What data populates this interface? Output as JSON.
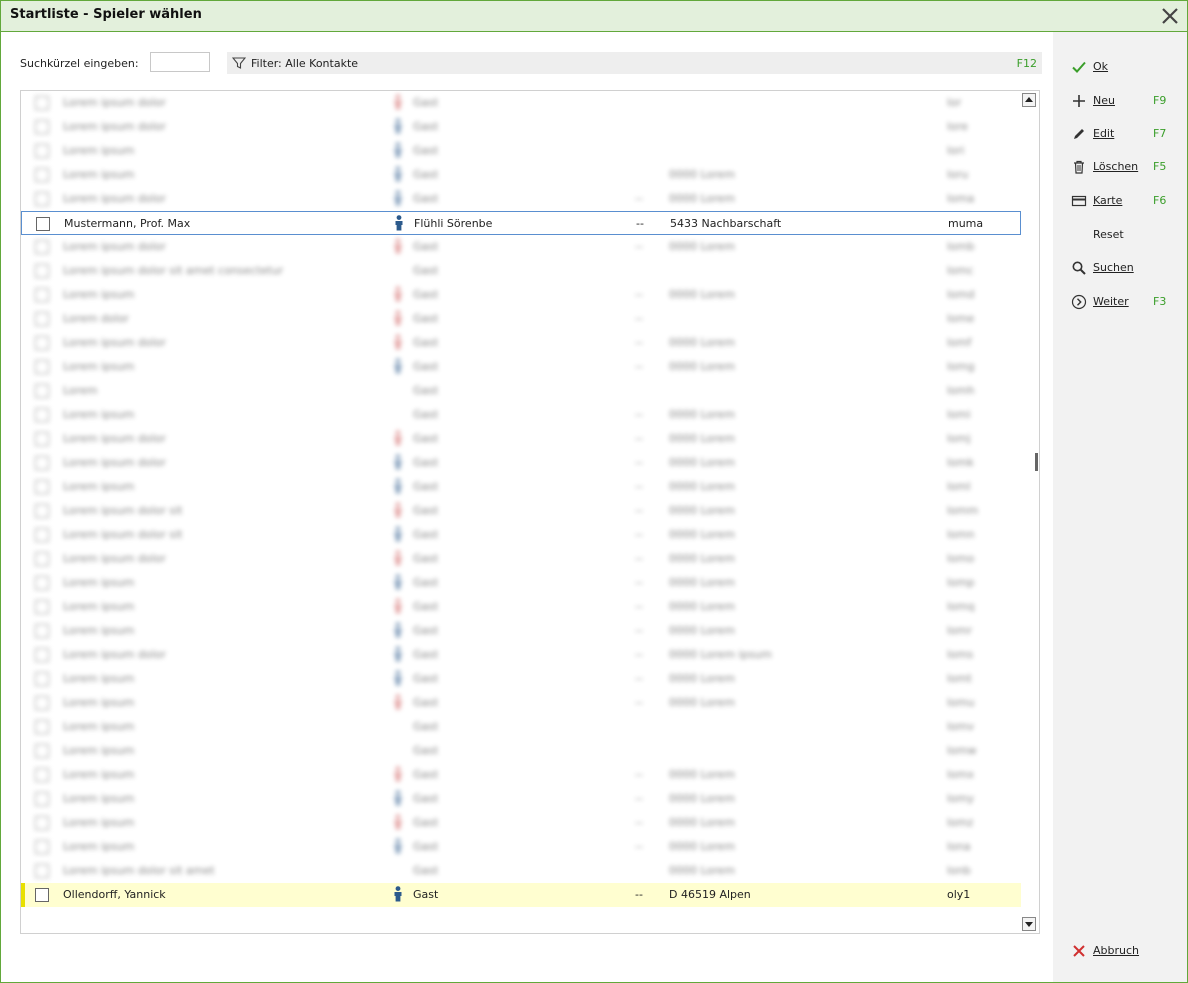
{
  "window": {
    "title": "Startliste - Spieler wählen"
  },
  "search": {
    "label": "Suchkürzel eingeben:",
    "value": "",
    "placeholder": ""
  },
  "filter": {
    "label": "Filter: Alle Kontakte",
    "shortcut": "F12"
  },
  "rows": [
    {
      "name": "Mustermann, Prof. Max",
      "club": "Flühli Sörenbe",
      "dash": "--",
      "address": "5433 Nachbarschaft",
      "code": "muma",
      "state": "selected"
    },
    {
      "name": "Ollendorff, Yannick",
      "club": "Gast",
      "dash": "--",
      "address": "D 46519 Alpen",
      "code": "oly1",
      "state": "highlighted"
    }
  ],
  "blurred_rows": [
    {
      "name": "Lorem ipsum dolor",
      "club": "Gast",
      "dash": "",
      "address": "",
      "code": "lor",
      "icon": "female"
    },
    {
      "name": "Lorem ipsum dolor",
      "club": "Gast",
      "dash": "",
      "address": "",
      "code": "lore",
      "icon": "male"
    },
    {
      "name": "Lorem ipsum",
      "club": "Gast",
      "dash": "",
      "address": "",
      "code": "lori",
      "icon": "male"
    },
    {
      "name": "Lorem ipsum",
      "club": "Gast",
      "dash": "",
      "address": "0000 Lorem",
      "code": "loru",
      "icon": "male"
    },
    {
      "name": "Lorem ipsum dolor",
      "club": "Gast",
      "dash": "--",
      "address": "0000 Lorem",
      "code": "loma",
      "icon": "male"
    },
    {
      "name": "Lorem ipsum dolor",
      "club": "Gast",
      "dash": "--",
      "address": "0000 Lorem",
      "code": "lomb",
      "icon": "female"
    },
    {
      "name": "Lorem ipsum dolor sit amet consectetur",
      "club": "Gast",
      "dash": "",
      "address": "",
      "code": "lomc",
      "icon": ""
    },
    {
      "name": "Lorem ipsum",
      "club": "Gast",
      "dash": "--",
      "address": "0000 Lorem",
      "code": "lomd",
      "icon": "female"
    },
    {
      "name": "Lorem dolor",
      "club": "Gast",
      "dash": "--",
      "address": "",
      "code": "lome",
      "icon": "female"
    },
    {
      "name": "Lorem ipsum dolor",
      "club": "Gast",
      "dash": "--",
      "address": "0000 Lorem",
      "code": "lomf",
      "icon": "female"
    },
    {
      "name": "Lorem ipsum",
      "club": "Gast",
      "dash": "--",
      "address": "0000 Lorem",
      "code": "lomg",
      "icon": "male"
    },
    {
      "name": "Lorem",
      "club": "Gast",
      "dash": "",
      "address": "",
      "code": "lomh",
      "icon": ""
    },
    {
      "name": "Lorem ipsum",
      "club": "Gast",
      "dash": "--",
      "address": "0000 Lorem",
      "code": "lomi",
      "icon": ""
    },
    {
      "name": "Lorem ipsum dolor",
      "club": "Gast",
      "dash": "--",
      "address": "0000 Lorem",
      "code": "lomj",
      "icon": "female"
    },
    {
      "name": "Lorem ipsum dolor",
      "club": "Gast",
      "dash": "--",
      "address": "0000 Lorem",
      "code": "lomk",
      "icon": "male"
    },
    {
      "name": "Lorem ipsum",
      "club": "Gast",
      "dash": "--",
      "address": "0000 Lorem",
      "code": "loml",
      "icon": "male"
    },
    {
      "name": "Lorem ipsum dolor sit",
      "club": "Gast",
      "dash": "--",
      "address": "0000 Lorem",
      "code": "lomm",
      "icon": "female"
    },
    {
      "name": "Lorem ipsum dolor sit",
      "club": "Gast",
      "dash": "--",
      "address": "0000 Lorem",
      "code": "lomn",
      "icon": "male"
    },
    {
      "name": "Lorem ipsum dolor",
      "club": "Gast",
      "dash": "--",
      "address": "0000 Lorem",
      "code": "lomo",
      "icon": "female"
    },
    {
      "name": "Lorem ipsum",
      "club": "Gast",
      "dash": "--",
      "address": "0000 Lorem",
      "code": "lomp",
      "icon": "male"
    },
    {
      "name": "Lorem ipsum",
      "club": "Gast",
      "dash": "--",
      "address": "0000 Lorem",
      "code": "lomq",
      "icon": "female"
    },
    {
      "name": "Lorem ipsum",
      "club": "Gast",
      "dash": "--",
      "address": "0000 Lorem",
      "code": "lomr",
      "icon": "male"
    },
    {
      "name": "Lorem ipsum dolor",
      "club": "Gast",
      "dash": "--",
      "address": "0000 Lorem ipsum",
      "code": "loms",
      "icon": "male"
    },
    {
      "name": "Lorem ipsum",
      "club": "Gast",
      "dash": "--",
      "address": "0000 Lorem",
      "code": "lomt",
      "icon": "male"
    },
    {
      "name": "Lorem ipsum",
      "club": "Gast",
      "dash": "--",
      "address": "0000 Lorem",
      "code": "lomu",
      "icon": "female"
    },
    {
      "name": "Lorem ipsum",
      "club": "Gast",
      "dash": "",
      "address": "",
      "code": "lomv",
      "icon": ""
    },
    {
      "name": "Lorem ipsum",
      "club": "Gast",
      "dash": "",
      "address": "",
      "code": "lomw",
      "icon": ""
    },
    {
      "name": "Lorem ipsum",
      "club": "Gast",
      "dash": "--",
      "address": "0000 Lorem",
      "code": "lomx",
      "icon": "female"
    },
    {
      "name": "Lorem ipsum",
      "club": "Gast",
      "dash": "--",
      "address": "0000 Lorem",
      "code": "lomy",
      "icon": "male"
    },
    {
      "name": "Lorem ipsum",
      "club": "Gast",
      "dash": "--",
      "address": "0000 Lorem",
      "code": "lomz",
      "icon": "female"
    },
    {
      "name": "Lorem ipsum",
      "club": "Gast",
      "dash": "--",
      "address": "0000 Lorem",
      "code": "lona",
      "icon": "male"
    },
    {
      "name": "Lorem ipsum dolor sit amet",
      "club": "Gast",
      "dash": "",
      "address": "0000 Lorem",
      "code": "lonb",
      "icon": ""
    }
  ],
  "actions": [
    {
      "id": "ok",
      "label": "Ok",
      "key": "",
      "icon": "check-icon"
    },
    {
      "id": "neu",
      "label": "Neu",
      "key": "F9",
      "icon": "plus-icon"
    },
    {
      "id": "edit",
      "label": "Edit",
      "key": "F7",
      "icon": "pencil-icon"
    },
    {
      "id": "loeschen",
      "label": "Löschen",
      "key": "F5",
      "icon": "trash-icon"
    },
    {
      "id": "karte",
      "label": "Karte",
      "key": "F6",
      "icon": "card-icon"
    },
    {
      "id": "reset",
      "label": "Reset",
      "key": "",
      "icon": ""
    },
    {
      "id": "suchen",
      "label": "Suchen",
      "key": "",
      "icon": "search-icon"
    },
    {
      "id": "weiter",
      "label": "Weiter",
      "key": "F3",
      "icon": "chevron-right-icon"
    },
    {
      "id": "abbruch",
      "label": "Abbruch",
      "key": "",
      "icon": "x-icon"
    }
  ],
  "colors": {
    "accent": "#62a83b",
    "shortcut": "#3a9e2a",
    "male": "#2c5a8c",
    "female": "#d06060",
    "selection": "#5a8fd0",
    "highlight": "#fffed0"
  }
}
